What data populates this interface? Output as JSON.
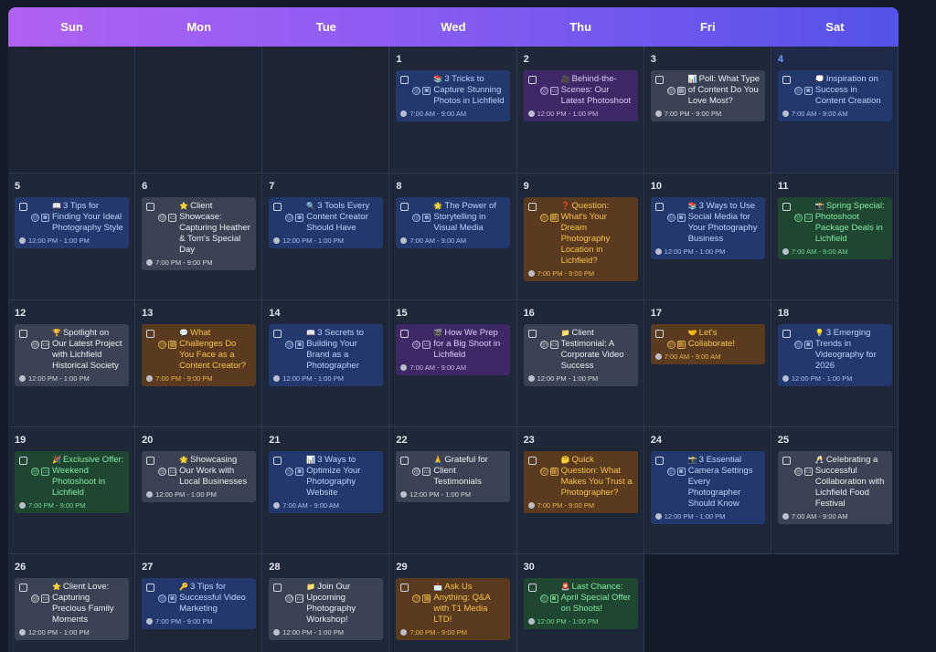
{
  "header": {
    "days": [
      "Sun",
      "Mon",
      "Tue",
      "Wed",
      "Thu",
      "Fri",
      "Sat"
    ]
  },
  "colors": {
    "blue": "#23396d",
    "purple": "#3e2865",
    "gray": "#3a4254",
    "orange": "#5a3b20",
    "green": "#1f4630",
    "today_number": "#6ea0ff"
  },
  "today": "4",
  "cells": [
    {
      "day": "",
      "events": []
    },
    {
      "day": "",
      "events": []
    },
    {
      "day": "",
      "events": []
    },
    {
      "day": "1",
      "events": [
        {
          "color": "blue",
          "emoji": "📚",
          "title": "3 Tricks to Capture Stunning Photos in Lichfield",
          "icons": [
            "instagram-icon",
            "camera-icon"
          ],
          "time": "7:00 AM - 9:00 AM"
        }
      ]
    },
    {
      "day": "2",
      "events": [
        {
          "color": "purple",
          "emoji": "🎥",
          "title": "Behind-the-Scenes: Our Latest Photoshoot",
          "icons": [
            "instagram-icon",
            "video-icon"
          ],
          "time": "12:00 PM - 1:00 PM"
        }
      ]
    },
    {
      "day": "3",
      "events": [
        {
          "color": "gray",
          "emoji": "📊",
          "title": "Poll: What Type of Content Do You Love Most?",
          "icons": [
            "instagram-icon",
            "gallery-icon"
          ],
          "time": "7:00 PM - 9:00 PM"
        }
      ]
    },
    {
      "day": "4",
      "events": [
        {
          "color": "blue",
          "emoji": "💭",
          "title": "Inspiration on Success in Content Creation",
          "icons": [
            "instagram-icon",
            "camera-icon"
          ],
          "time": "7:00 AM - 9:00 AM"
        }
      ]
    },
    {
      "day": "5",
      "events": [
        {
          "color": "blue",
          "emoji": "📖",
          "title": "3 Tips for Finding Your Ideal Photography Style",
          "icons": [
            "instagram-icon",
            "camera-icon"
          ],
          "time": "12:00 PM - 1:00 PM"
        }
      ]
    },
    {
      "day": "6",
      "events": [
        {
          "color": "gray",
          "emoji": "⭐",
          "title": "Client Showcase: Capturing Heather & Tom's Special Day",
          "icons": [
            "instagram-icon",
            "video-icon"
          ],
          "time": "7:00 PM - 9:00 PM"
        }
      ]
    },
    {
      "day": "7",
      "events": [
        {
          "color": "blue",
          "emoji": "🔍",
          "title": "3 Tools Every Content Creator Should Have",
          "icons": [
            "instagram-icon",
            "camera-icon"
          ],
          "time": "12:00 PM - 1:00 PM"
        }
      ]
    },
    {
      "day": "8",
      "events": [
        {
          "color": "blue",
          "emoji": "🌟",
          "title": "The Power of Storytelling in Visual Media",
          "icons": [
            "instagram-icon",
            "camera-icon"
          ],
          "time": "7:00 AM - 9:00 AM"
        }
      ]
    },
    {
      "day": "9",
      "events": [
        {
          "color": "orange",
          "emoji": "❓",
          "title": "Question: What's Your Dream Photography Location in Lichfield?",
          "icons": [
            "instagram-icon",
            "gallery-icon"
          ],
          "time": "7:00 PM - 9:00 PM"
        }
      ]
    },
    {
      "day": "10",
      "events": [
        {
          "color": "blue",
          "emoji": "📚",
          "title": "3 Ways to Use Social Media for Your Photography Business",
          "icons": [
            "instagram-icon",
            "camera-icon"
          ],
          "time": "12:00 PM - 1:00 PM"
        }
      ]
    },
    {
      "day": "11",
      "events": [
        {
          "color": "green",
          "emoji": "📸",
          "title": "Spring Special: Photoshoot Package Deals in Lichfield",
          "icons": [
            "instagram-icon",
            "video-icon"
          ],
          "time": "7:00 AM - 9:00 AM"
        }
      ]
    },
    {
      "day": "12",
      "events": [
        {
          "color": "gray",
          "emoji": "🏆",
          "title": "Spotlight on Our Latest Project with Lichfield Historical Society",
          "icons": [
            "instagram-icon",
            "video-icon"
          ],
          "time": "12:00 PM - 1:00 PM"
        }
      ]
    },
    {
      "day": "13",
      "events": [
        {
          "color": "orange",
          "emoji": "💬",
          "title": "What Challenges Do You Face as a Content Creator?",
          "icons": [
            "instagram-icon",
            "gallery-icon"
          ],
          "time": "7:00 PM - 9:00 PM"
        }
      ]
    },
    {
      "day": "14",
      "events": [
        {
          "color": "blue",
          "emoji": "📖",
          "title": "3 Secrets to Building Your Brand as a Photographer",
          "icons": [
            "instagram-icon",
            "camera-icon"
          ],
          "time": "12:00 PM - 1:00 PM"
        }
      ]
    },
    {
      "day": "15",
      "events": [
        {
          "color": "purple",
          "emoji": "🎬",
          "title": "How We Prep for a Big Shoot in Lichfield",
          "icons": [
            "instagram-icon",
            "video-icon"
          ],
          "time": "7:00 AM - 9:00 AM"
        }
      ]
    },
    {
      "day": "16",
      "events": [
        {
          "color": "gray",
          "emoji": "📁",
          "title": "Client Testimonial: A Corporate Video Success",
          "icons": [
            "instagram-icon",
            "video-icon"
          ],
          "time": "12:00 PM - 1:00 PM"
        }
      ]
    },
    {
      "day": "17",
      "events": [
        {
          "color": "orange",
          "emoji": "🤝",
          "title": "Let's Collaborate!",
          "icons": [
            "instagram-icon",
            "gallery-icon"
          ],
          "time": "7:00 AM - 9:00 AM"
        }
      ]
    },
    {
      "day": "18",
      "events": [
        {
          "color": "blue",
          "emoji": "💡",
          "title": "3 Emerging Trends in Videography for 2026",
          "icons": [
            "instagram-icon",
            "camera-icon"
          ],
          "time": "12:00 PM - 1:00 PM"
        }
      ]
    },
    {
      "day": "19",
      "events": [
        {
          "color": "green",
          "emoji": "🎉",
          "title": "Exclusive Offer: Weekend Photoshoot in Lichfield",
          "icons": [
            "instagram-icon",
            "video-icon"
          ],
          "time": "7:00 PM - 9:00 PM"
        }
      ]
    },
    {
      "day": "20",
      "events": [
        {
          "color": "gray",
          "emoji": "🌟",
          "title": "Showcasing Our Work with Local Businesses",
          "icons": [
            "instagram-icon",
            "video-icon"
          ],
          "time": "12:00 PM - 1:00 PM"
        }
      ]
    },
    {
      "day": "21",
      "events": [
        {
          "color": "blue",
          "emoji": "📊",
          "title": "3 Ways to Optimize Your Photography Website",
          "icons": [
            "instagram-icon",
            "camera-icon"
          ],
          "time": "7:00 AM - 9:00 AM"
        }
      ]
    },
    {
      "day": "22",
      "events": [
        {
          "color": "gray",
          "emoji": "🙏",
          "title": "Grateful for Client Testimonials",
          "icons": [
            "instagram-icon",
            "video-icon"
          ],
          "time": "12:00 PM - 1:00 PM"
        }
      ]
    },
    {
      "day": "23",
      "events": [
        {
          "color": "orange",
          "emoji": "🤔",
          "title": "Quick Question: What Makes You Trust a Photographer?",
          "icons": [
            "instagram-icon",
            "gallery-icon"
          ],
          "time": "7:00 PM - 9:00 PM"
        }
      ]
    },
    {
      "day": "24",
      "events": [
        {
          "color": "blue",
          "emoji": "📸",
          "title": "3 Essential Camera Settings Every Photographer Should Know",
          "icons": [
            "instagram-icon",
            "camera-icon"
          ],
          "time": "12:00 PM - 1:00 PM"
        }
      ]
    },
    {
      "day": "25",
      "events": [
        {
          "color": "gray",
          "emoji": "🥂",
          "title": "Celebrating a Successful Collaboration with Lichfield Food Festival",
          "icons": [
            "instagram-icon",
            "video-icon"
          ],
          "time": "7:00 AM - 9:00 AM"
        }
      ]
    },
    {
      "day": "26",
      "events": [
        {
          "color": "gray",
          "emoji": "⭐",
          "title": "Client Love: Capturing Precious Family Moments",
          "icons": [
            "instagram-icon",
            "video-icon"
          ],
          "time": "12:00 PM - 1:00 PM"
        }
      ]
    },
    {
      "day": "27",
      "events": [
        {
          "color": "blue",
          "emoji": "🔑",
          "title": "3 Tips for Successful Video Marketing",
          "icons": [
            "instagram-icon",
            "camera-icon"
          ],
          "time": "7:00 PM - 9:00 PM"
        }
      ]
    },
    {
      "day": "28",
      "events": [
        {
          "color": "gray",
          "emoji": "📁",
          "title": "Join Our Upcoming Photography Workshop!",
          "icons": [
            "instagram-icon",
            "video-icon"
          ],
          "time": "12:00 PM - 1:00 PM"
        }
      ]
    },
    {
      "day": "29",
      "events": [
        {
          "color": "orange",
          "emoji": "📩",
          "title": "Ask Us Anything: Q&A with T1 Media LTD!",
          "icons": [
            "instagram-icon",
            "gallery-icon"
          ],
          "time": "7:00 PM - 9:00 PM"
        }
      ]
    },
    {
      "day": "30",
      "events": [
        {
          "color": "green",
          "emoji": "🚨",
          "title": "Last Chance: April Special Offer on Shoots!",
          "icons": [
            "instagram-icon",
            "camera-icon"
          ],
          "time": "12:00 PM - 1:00 PM"
        }
      ]
    }
  ]
}
